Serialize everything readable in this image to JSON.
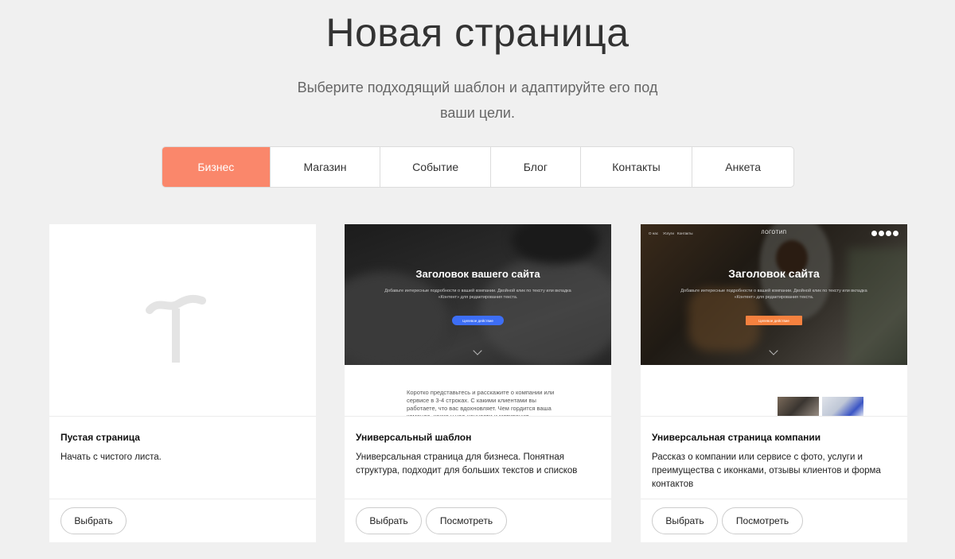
{
  "header": {
    "title": "Новая страница",
    "subtitle": "Выберите подходящий шаблон и адаптируйте его под ваши цели."
  },
  "tabs": [
    {
      "label": "Бизнес",
      "active": true
    },
    {
      "label": "Магазин",
      "active": false
    },
    {
      "label": "Событие",
      "active": false
    },
    {
      "label": "Блог",
      "active": false
    },
    {
      "label": "Контакты",
      "active": false
    },
    {
      "label": "Анкета",
      "active": false
    }
  ],
  "colors": {
    "accent": "#fa876b",
    "primary_button": "#3d6ef5",
    "cta_orange": "#f5813f"
  },
  "cards": [
    {
      "name": "Пустая страница",
      "description": "Начать с чистого листа.",
      "select_label": "Выбрать"
    },
    {
      "name": "Универсальный шаблон",
      "description": "Универсальная страница для бизнеса. Понятная структура, подходит для больших текстов и списков",
      "select_label": "Выбрать",
      "preview_label": "Посмотреть",
      "preview": {
        "hero_title": "Заголовок вашего сайта",
        "hero_subtitle": "Добавьте интересные подробности о вашей компании. Двойной клик по тексту или вкладка «Контент» для редактирования текста.",
        "hero_button": "Целевое действие",
        "body_text": "Коротко представьтесь и расскажите о компании или сервисе в 3-4 строках. С какими клиентами вы работаете, что вас вдохновляет. Чем гордится ваша команда, какие у нее ценности и мотивация."
      }
    },
    {
      "name": "Универсальная страница компании",
      "description": "Рассказ о компании или сервисе с фото, услуги и преимущества с иконками, отзывы клиентов и форма контактов",
      "select_label": "Выбрать",
      "preview_label": "Посмотреть",
      "preview": {
        "nav": [
          "О нас",
          "Услуги",
          "Контакты"
        ],
        "logo": "ЛОГОТИП",
        "hero_title": "Заголовок сайта",
        "hero_subtitle": "Добавьте интересные подробности о вашей компании. Двойной клик по тексту или вкладка «Контент» для редактирования текста.",
        "hero_button": "Целевое действие",
        "social_icons": [
          "facebook-icon",
          "twitter-icon",
          "vk-icon",
          "telegram-icon"
        ]
      }
    }
  ]
}
